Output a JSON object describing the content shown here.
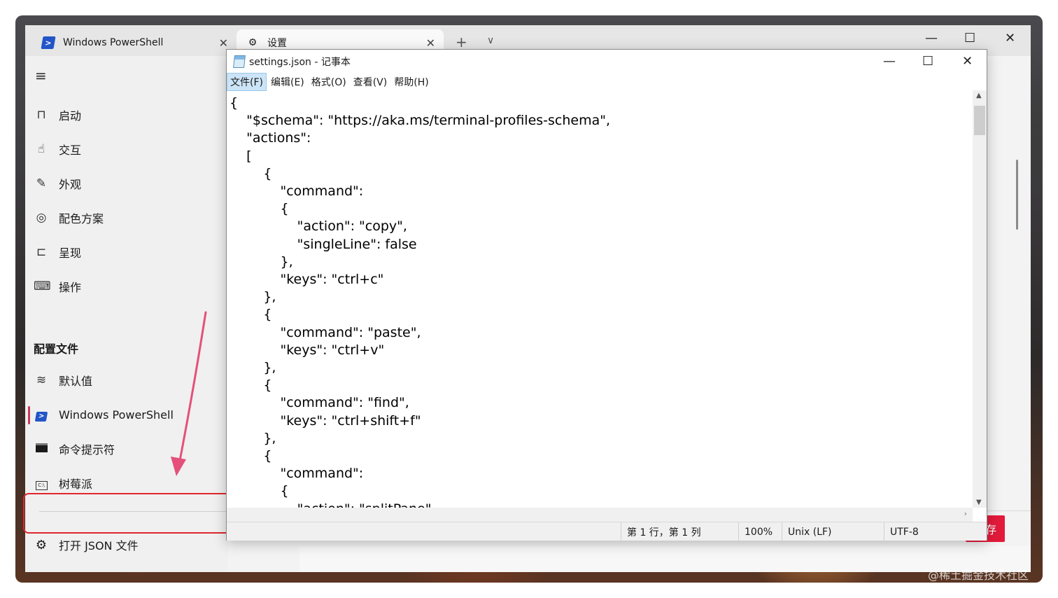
{
  "terminal": {
    "tabs": [
      {
        "label": "Windows PowerShell",
        "icon": "powershell-icon"
      },
      {
        "label": "设置",
        "icon": "gear-icon"
      }
    ],
    "tab_close": "✕",
    "new_tab": "+",
    "tab_dropdown": "∨",
    "controls": {
      "minimize": "—",
      "maximize": "☐",
      "close": "✕"
    }
  },
  "sidebar": {
    "menu_icon": "≡",
    "items": [
      {
        "label": "启动",
        "icon": "startup-icon"
      },
      {
        "label": "交互",
        "icon": "interaction-icon"
      },
      {
        "label": "外观",
        "icon": "appearance-icon"
      },
      {
        "label": "配色方案",
        "icon": "palette-icon"
      },
      {
        "label": "呈现",
        "icon": "rendering-icon"
      },
      {
        "label": "操作",
        "icon": "keyboard-icon"
      }
    ],
    "section_title": "配置文件",
    "profiles": [
      {
        "label": "默认值",
        "icon": "layers-icon"
      },
      {
        "label": "Windows PowerShell",
        "icon": "powershell-icon",
        "active": true
      },
      {
        "label": "命令提示符",
        "icon": "cmd-icon"
      },
      {
        "label": "树莓派",
        "icon": "terminal-icon"
      }
    ],
    "open_json": {
      "label": "打开 JSON 文件",
      "icon": "gear-icon"
    }
  },
  "save_button": {
    "label": "存"
  },
  "notepad": {
    "title": "settings.json - 记事本",
    "controls": {
      "minimize": "—",
      "maximize": "☐",
      "close": "✕"
    },
    "menu": [
      "文件(F)",
      "编辑(E)",
      "格式(O)",
      "查看(V)",
      "帮助(H)"
    ],
    "lines": [
      "{",
      "    \"$schema\": \"https://aka.ms/terminal-profiles-schema\",",
      "    \"actions\": ",
      "    [",
      "        {",
      "            \"command\": ",
      "            {",
      "                \"action\": \"copy\",",
      "                \"singleLine\": false",
      "            },",
      "            \"keys\": \"ctrl+c\"",
      "        },",
      "        {",
      "            \"command\": \"paste\",",
      "            \"keys\": \"ctrl+v\"",
      "        },",
      "        {",
      "            \"command\": \"find\",",
      "            \"keys\": \"ctrl+shift+f\"",
      "        },",
      "        {",
      "            \"command\": ",
      "            {",
      "                \"action\": \"splitPane\","
    ],
    "status": {
      "position": "第 1 行，第 1 列",
      "zoom": "100%",
      "line_ending": "Unix (LF)",
      "encoding": "UTF-8"
    }
  },
  "watermark": "@稀土掘金技术社区",
  "colors": {
    "accent_red": "#e31b3b",
    "annotation_red": "#e0262b",
    "arrow_pink": "#e4507a",
    "active_bar": "#c73b5a"
  }
}
